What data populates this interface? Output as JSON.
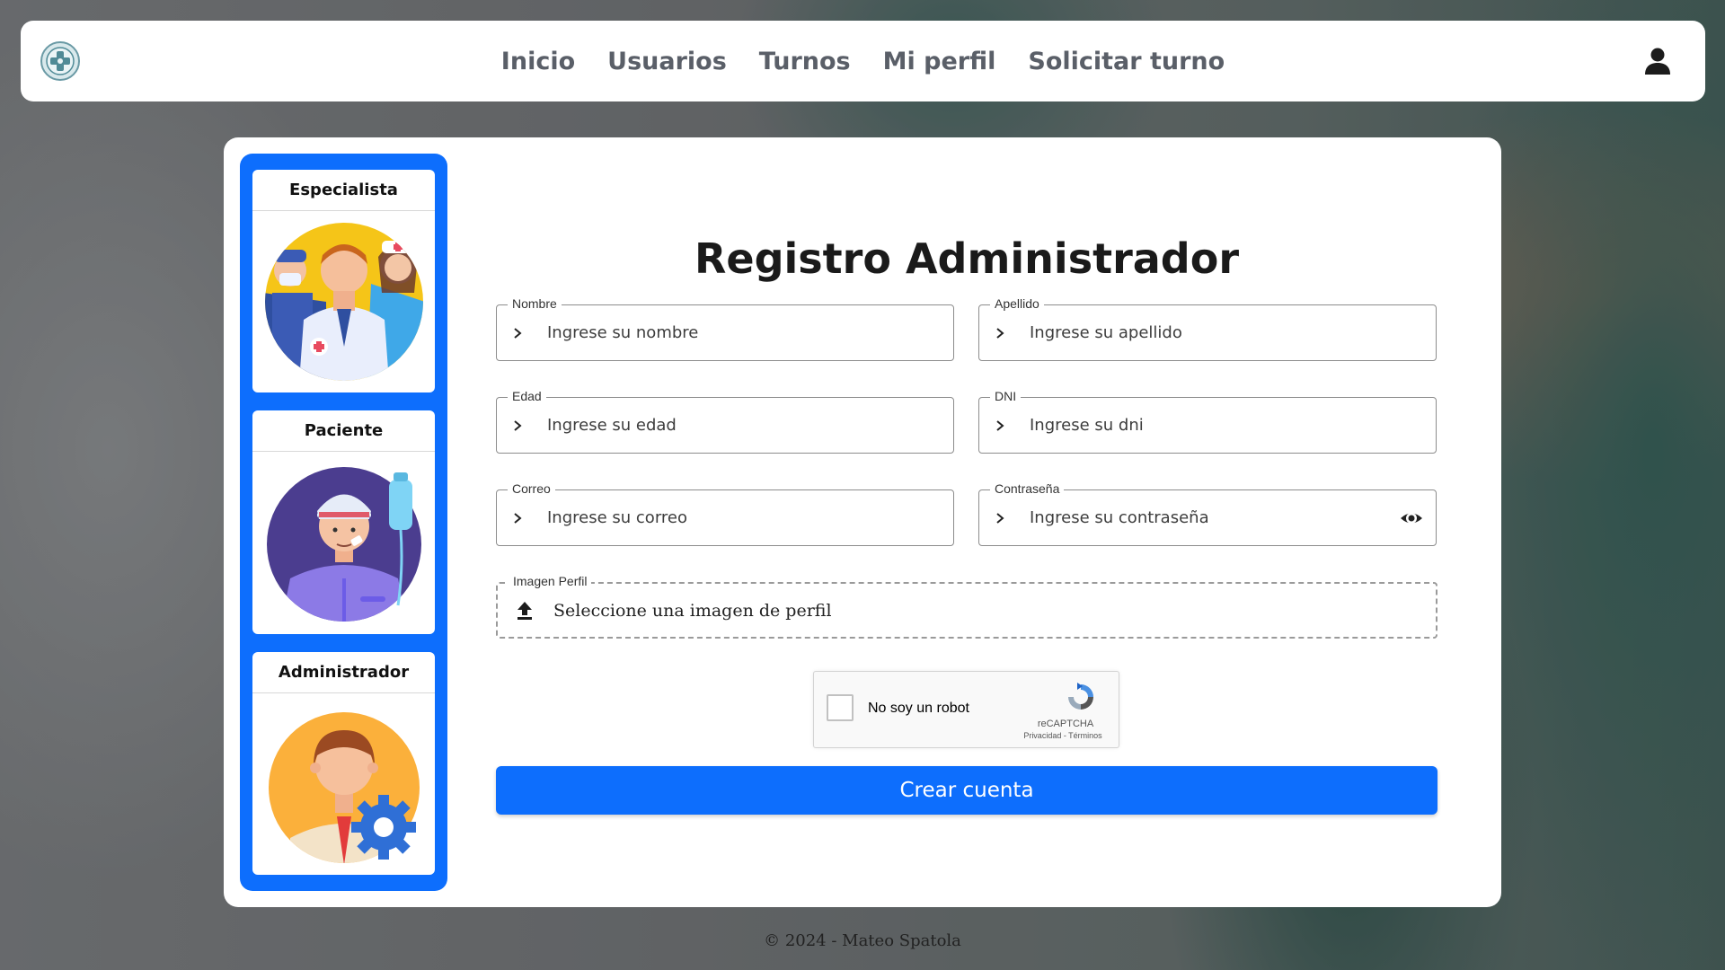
{
  "navbar": {
    "links": [
      "Inicio",
      "Usuarios",
      "Turnos",
      "Mi perfil",
      "Solicitar turno"
    ]
  },
  "sidebar": {
    "roles": [
      {
        "label": "Especialista",
        "icon": "doctors-group-illustration"
      },
      {
        "label": "Paciente",
        "icon": "injured-patient-illustration"
      },
      {
        "label": "Administrador",
        "icon": "admin-gear-illustration"
      }
    ]
  },
  "form": {
    "title": "Registro Administrador",
    "fields": {
      "nombre": {
        "label": "Nombre",
        "placeholder": "Ingrese su nombre"
      },
      "apellido": {
        "label": "Apellido",
        "placeholder": "Ingrese su apellido"
      },
      "edad": {
        "label": "Edad",
        "placeholder": "Ingrese su edad"
      },
      "dni": {
        "label": "DNI",
        "placeholder": "Ingrese su dni"
      },
      "correo": {
        "label": "Correo",
        "placeholder": "Ingrese su correo"
      },
      "password": {
        "label": "Contraseña",
        "placeholder": "Ingrese su contraseña"
      }
    },
    "image": {
      "label": "Imagen Perfil",
      "text": "Seleccione una imagen de perfil"
    },
    "recaptcha": {
      "label": "No soy un robot",
      "brand": "reCAPTCHA",
      "links": "Privacidad - Términos"
    },
    "submit": "Crear cuenta"
  },
  "footer": {
    "text": "© 2024 - Mateo Spatola"
  },
  "colors": {
    "primary": "#0d6efd",
    "nav_text": "#5a5f68"
  }
}
